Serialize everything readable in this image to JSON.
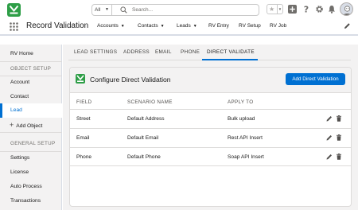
{
  "header": {
    "search_scope": "All",
    "search_placeholder": "Search..."
  },
  "app": {
    "name": "Record Validation",
    "nav": [
      {
        "label": "Accounts",
        "has_menu": true
      },
      {
        "label": "Contacts",
        "has_menu": true
      },
      {
        "label": "Leads",
        "has_menu": true
      },
      {
        "label": "RV Entry",
        "has_menu": false
      },
      {
        "label": "RV Setup",
        "has_menu": false
      },
      {
        "label": "RV Job",
        "has_menu": false
      }
    ]
  },
  "sidebar": {
    "home": "RV Home",
    "section_object": "OBJECT SETUP",
    "objects": [
      "Account",
      "Contact",
      "Lead"
    ],
    "active": "Lead",
    "add_object": "Add Object",
    "section_general": "GENERAL SETUP",
    "general": [
      "Settings",
      "License",
      "Auto Process",
      "Transactions"
    ]
  },
  "tabs": [
    "LEAD SETTINGS",
    "ADDRESS",
    "EMAIL",
    "PHONE",
    "DIRECT VALIDATE"
  ],
  "active_tab": "DIRECT VALIDATE",
  "card": {
    "title": "Configure Direct Validation",
    "add_button": "Add Direct Validation",
    "columns": [
      "FIELD",
      "SCENARIO NAME",
      "APPLY TO"
    ],
    "rows": [
      {
        "field": "Street",
        "scenario": "Default Address",
        "apply_to": "Bulk upload"
      },
      {
        "field": "Email",
        "scenario": "Default Email",
        "apply_to": "Rest API Insert"
      },
      {
        "field": "Phone",
        "scenario": "Default Phone",
        "apply_to": "Soap API Insert"
      }
    ]
  },
  "colors": {
    "brand_green": "#2e9e47",
    "accent_blue": "#0070d2"
  }
}
